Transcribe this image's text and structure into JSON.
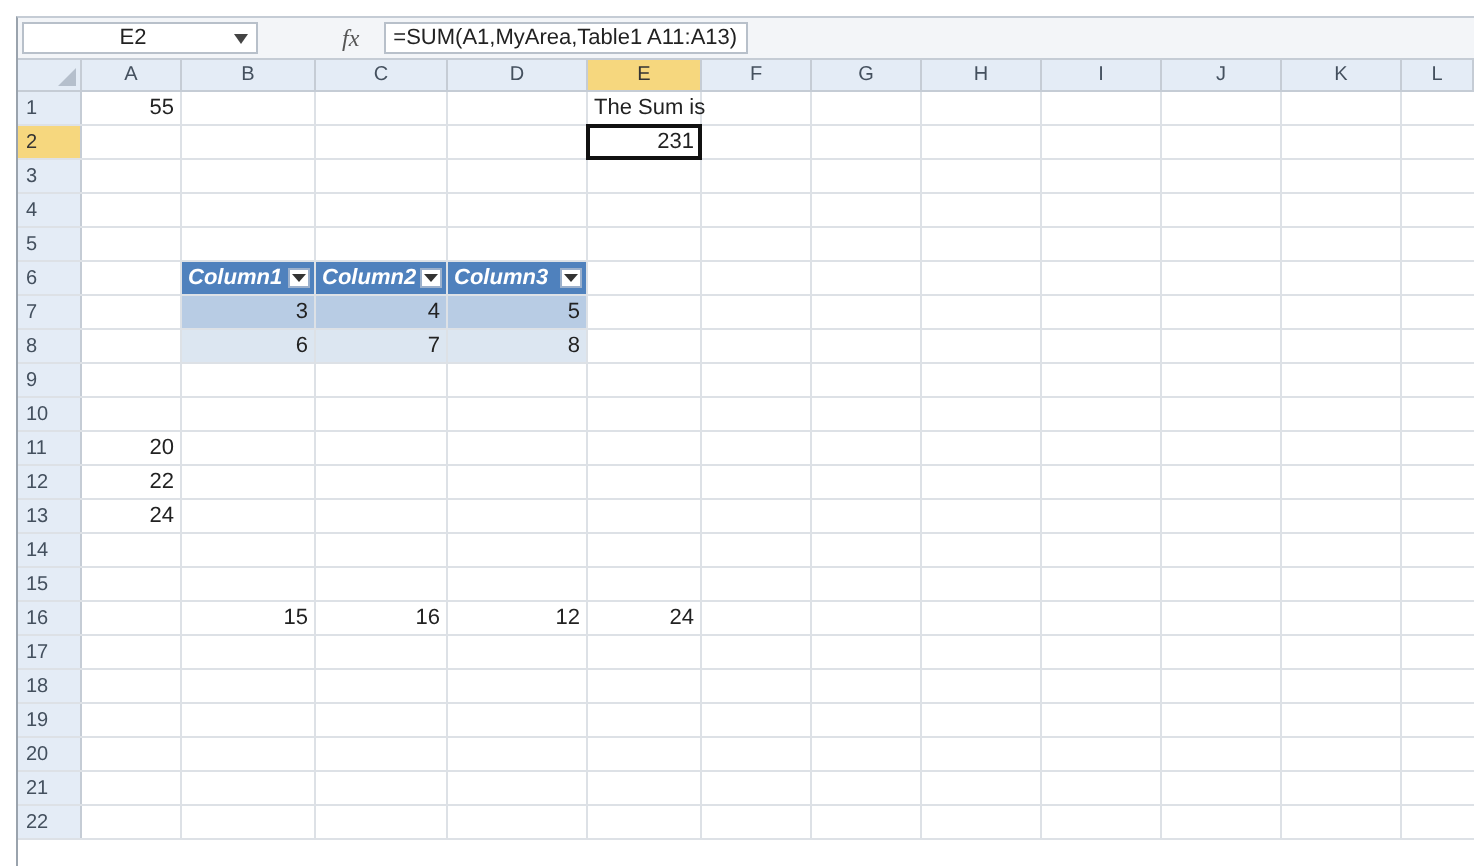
{
  "name_box": "E2",
  "function_label": "fx",
  "formula": "=SUM(A1,MyArea,Table1 A11:A13)",
  "columns": [
    {
      "label": "A",
      "selected": false
    },
    {
      "label": "B",
      "selected": false
    },
    {
      "label": "C",
      "selected": false
    },
    {
      "label": "D",
      "selected": false
    },
    {
      "label": "E",
      "selected": true
    },
    {
      "label": "F",
      "selected": false
    },
    {
      "label": "G",
      "selected": false
    },
    {
      "label": "H",
      "selected": false
    },
    {
      "label": "I",
      "selected": false
    },
    {
      "label": "J",
      "selected": false
    },
    {
      "label": "K",
      "selected": false
    },
    {
      "label": "L",
      "selected": false
    }
  ],
  "rows": [
    {
      "label": "1",
      "selected": false,
      "cells": {
        "A": {
          "value": "55",
          "kind": "number",
          "selected": false
        },
        "E": {
          "value": "The Sum is",
          "kind": "text",
          "selected": false
        }
      }
    },
    {
      "label": "2",
      "selected": true,
      "cells": {
        "E": {
          "value": "231",
          "kind": "number",
          "selected": true
        }
      }
    },
    {
      "label": "3",
      "selected": false
    },
    {
      "label": "4",
      "selected": false
    },
    {
      "label": "5",
      "selected": false
    },
    {
      "label": "6",
      "selected": false,
      "cells": {
        "B": {
          "value": "Column1",
          "kind": "table_header",
          "selected": false
        },
        "C": {
          "value": "Column2",
          "kind": "table_header",
          "selected": false
        },
        "D": {
          "value": "Column3",
          "kind": "table_header",
          "selected": false
        }
      }
    },
    {
      "label": "7",
      "selected": false,
      "cells": {
        "B": {
          "value": "3",
          "kind": "table_band",
          "selected": false
        },
        "C": {
          "value": "4",
          "kind": "table_band",
          "selected": false
        },
        "D": {
          "value": "5",
          "kind": "table_band",
          "selected": false
        }
      }
    },
    {
      "label": "8",
      "selected": false,
      "cells": {
        "B": {
          "value": "6",
          "kind": "table_light",
          "selected": false
        },
        "C": {
          "value": "7",
          "kind": "table_light",
          "selected": false
        },
        "D": {
          "value": "8",
          "kind": "table_light",
          "selected": false
        }
      }
    },
    {
      "label": "9",
      "selected": false
    },
    {
      "label": "10",
      "selected": false
    },
    {
      "label": "11",
      "selected": false,
      "cells": {
        "A": {
          "value": "20",
          "kind": "number",
          "selected": false
        }
      }
    },
    {
      "label": "12",
      "selected": false,
      "cells": {
        "A": {
          "value": "22",
          "kind": "number",
          "selected": false
        }
      }
    },
    {
      "label": "13",
      "selected": false,
      "cells": {
        "A": {
          "value": "24",
          "kind": "number",
          "selected": false
        }
      }
    },
    {
      "label": "14",
      "selected": false
    },
    {
      "label": "15",
      "selected": false
    },
    {
      "label": "16",
      "selected": false,
      "cells": {
        "B": {
          "value": "15",
          "kind": "number",
          "selected": false
        },
        "C": {
          "value": "16",
          "kind": "number",
          "selected": false
        },
        "D": {
          "value": "12",
          "kind": "number",
          "selected": false
        },
        "E": {
          "value": "24",
          "kind": "number",
          "selected": false
        }
      }
    },
    {
      "label": "17",
      "selected": false
    },
    {
      "label": "18",
      "selected": false
    },
    {
      "label": "19",
      "selected": false
    },
    {
      "label": "20",
      "selected": false
    },
    {
      "label": "21",
      "selected": false
    },
    {
      "label": "22",
      "selected": false
    }
  ]
}
